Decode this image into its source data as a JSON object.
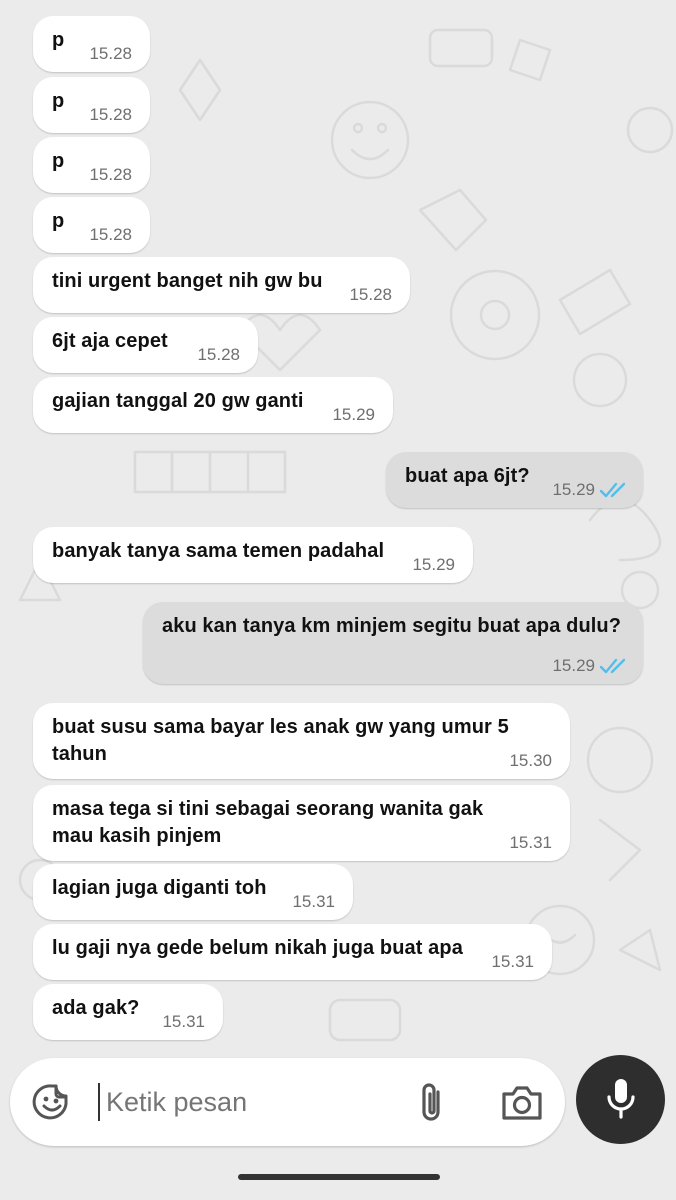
{
  "messages": [
    {
      "direction": "incoming",
      "text": "p",
      "time": "15.28"
    },
    {
      "direction": "incoming",
      "text": "p",
      "time": "15.28"
    },
    {
      "direction": "incoming",
      "text": "p",
      "time": "15.28"
    },
    {
      "direction": "incoming",
      "text": "p",
      "time": "15.28"
    },
    {
      "direction": "incoming",
      "text": "tini urgent banget nih gw bu",
      "time": "15.28"
    },
    {
      "direction": "incoming",
      "text": "6jt aja cepet",
      "time": "15.28"
    },
    {
      "direction": "incoming",
      "text": "gajian tanggal 20 gw ganti",
      "time": "15.29"
    },
    {
      "direction": "outgoing",
      "text": "buat apa 6jt?",
      "time": "15.29",
      "status": "read"
    },
    {
      "direction": "incoming",
      "text": "banyak tanya sama temen padahal",
      "time": "15.29"
    },
    {
      "direction": "outgoing",
      "text": "aku kan tanya km minjem segitu buat apa dulu?",
      "time": "15.29",
      "status": "read"
    },
    {
      "direction": "incoming",
      "text": "buat susu sama bayar les anak gw yang umur 5 tahun",
      "time": "15.30"
    },
    {
      "direction": "incoming",
      "text": "masa tega si tini sebagai seorang wanita gak mau kasih pinjem",
      "time": "15.31"
    },
    {
      "direction": "incoming",
      "text": "lagian juga diganti toh",
      "time": "15.31"
    },
    {
      "direction": "incoming",
      "text": "lu gaji nya gede belum nikah juga buat apa",
      "time": "15.31"
    },
    {
      "direction": "incoming",
      "text": "ada gak?",
      "time": "15.31"
    }
  ],
  "input": {
    "placeholder": "Ketik pesan",
    "value": ""
  },
  "icons": {
    "emoji": "sticker-smile-icon",
    "attach": "paperclip-icon",
    "camera": "camera-icon",
    "mic": "microphone-icon",
    "read_receipt": "double-check-icon"
  },
  "colors": {
    "read_tick": "#53bdeb",
    "incoming_bubble": "#ffffff",
    "outgoing_bubble": "#dcdcdc",
    "mic_button": "#2e2e2e"
  }
}
